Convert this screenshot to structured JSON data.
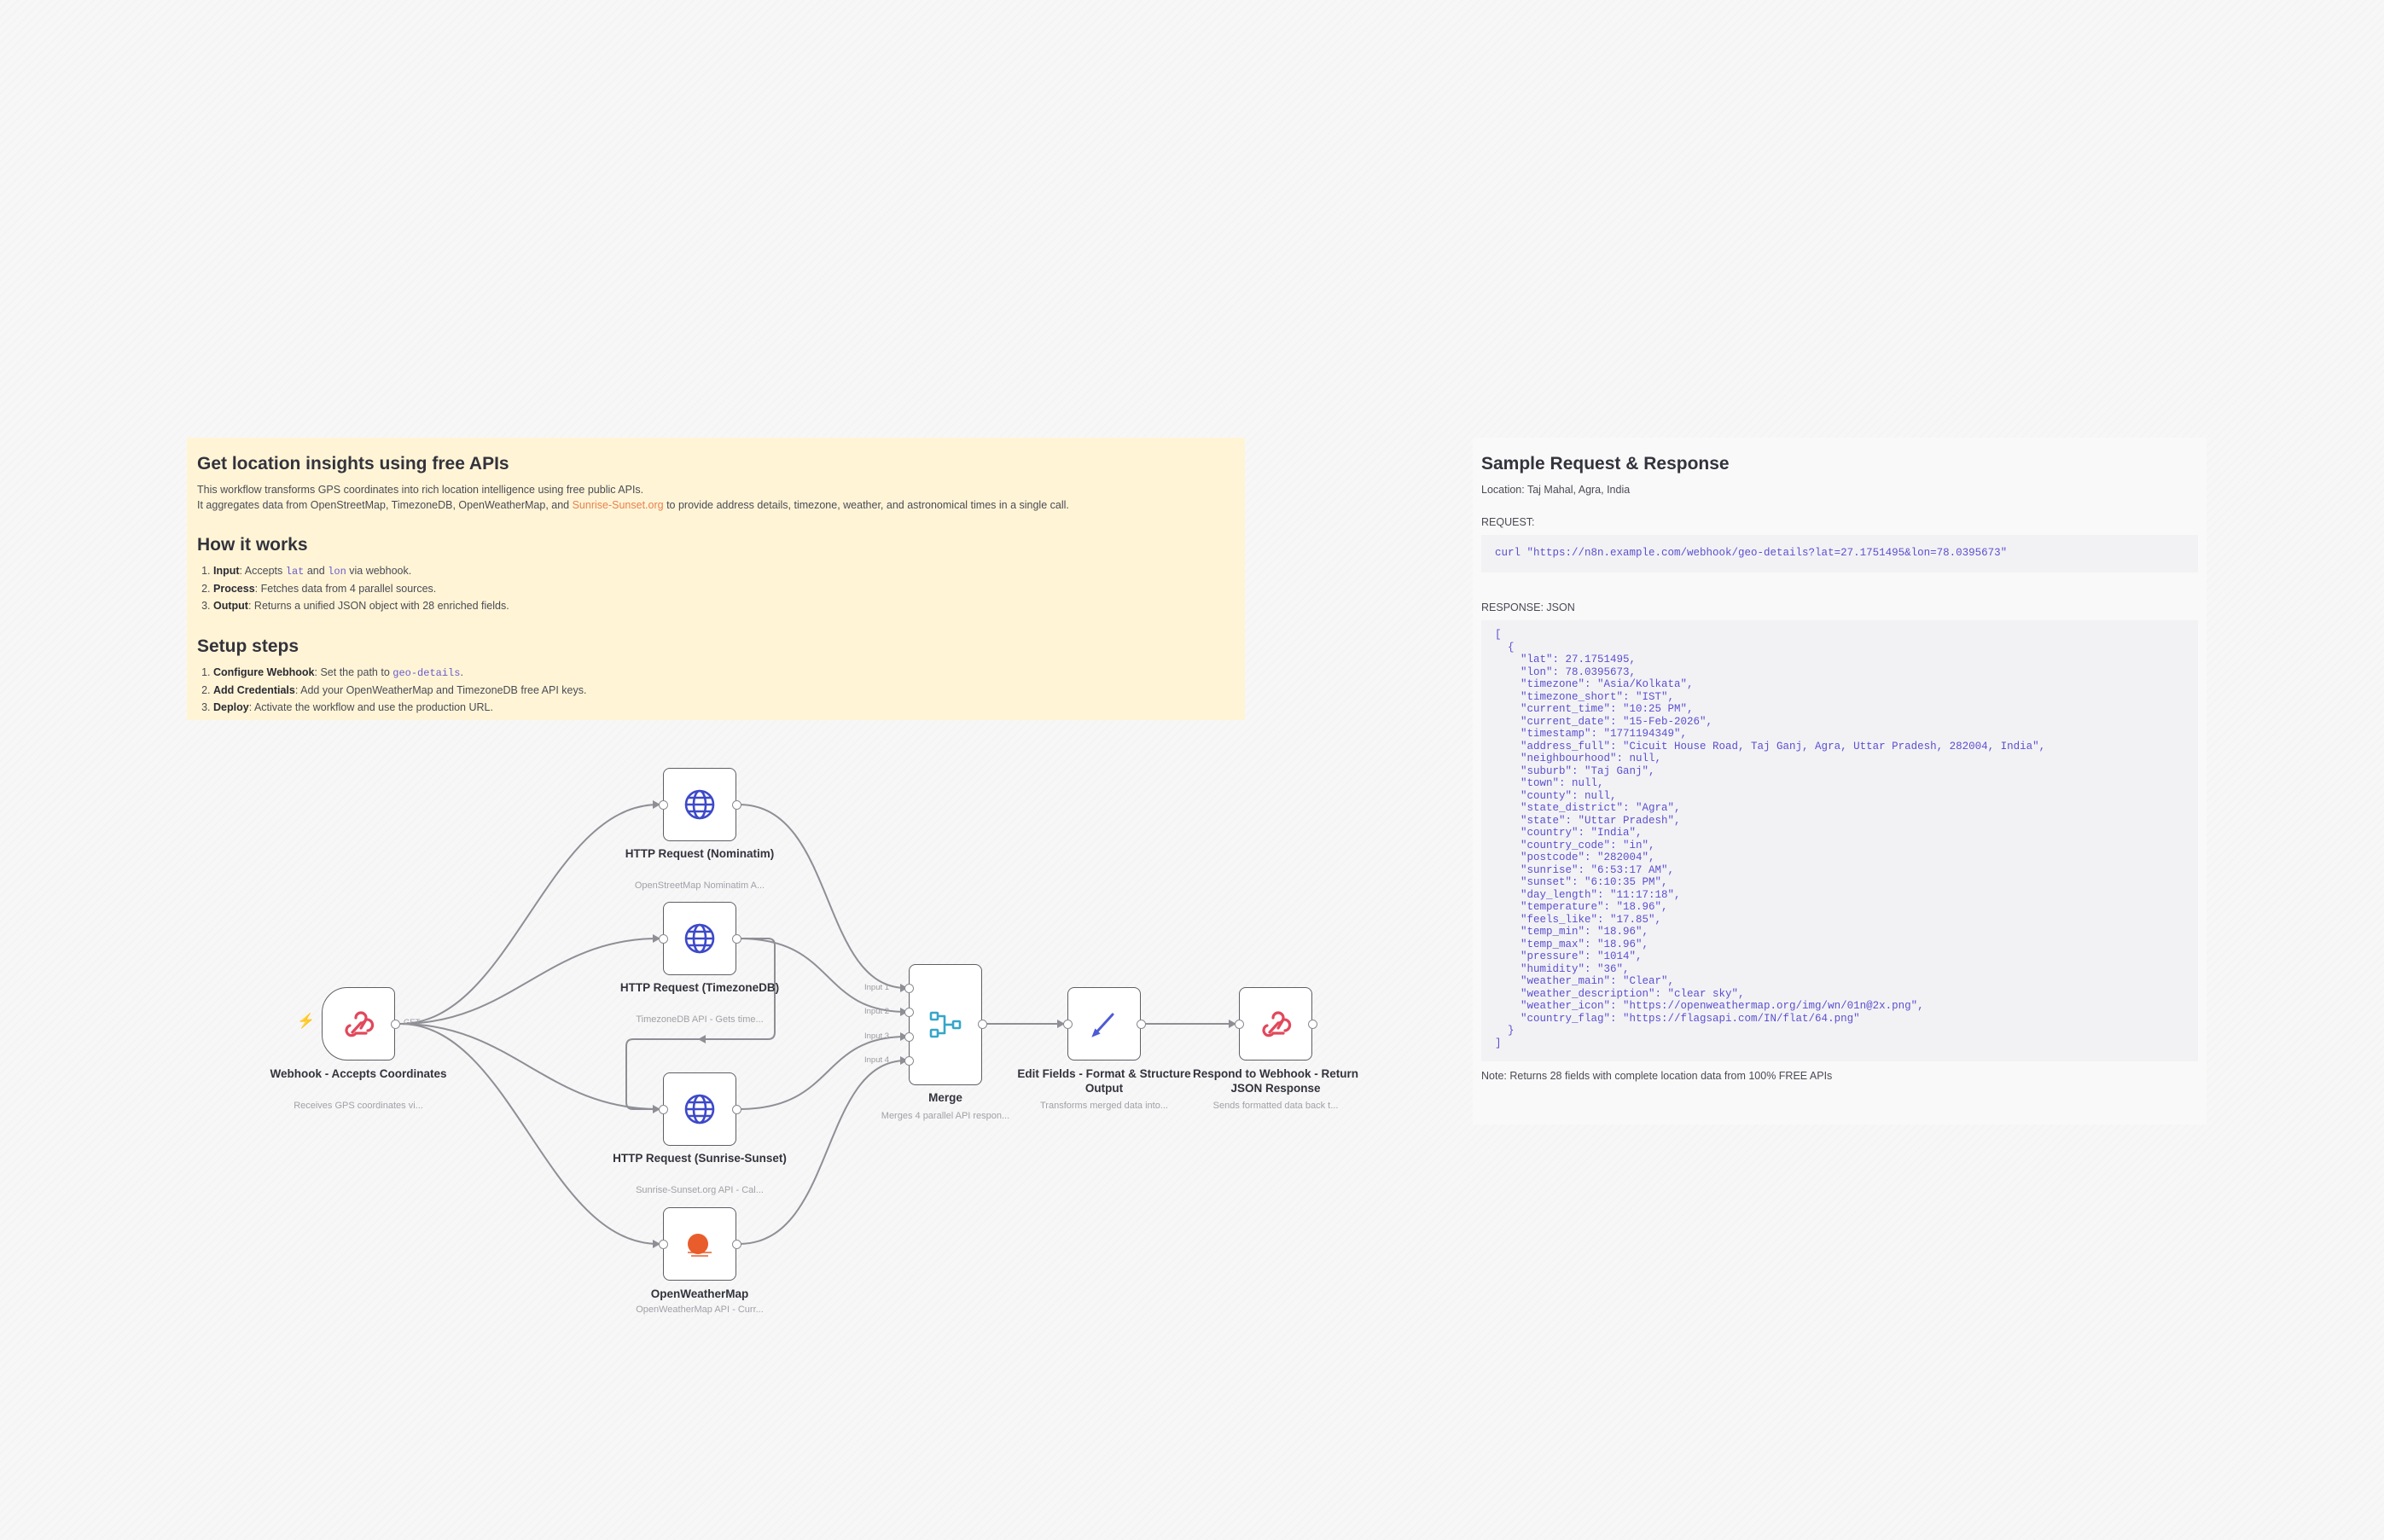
{
  "sticky_info": {
    "title": "Get location insights using free APIs",
    "intro_line1": "This workflow transforms GPS coordinates into rich location intelligence using free public APIs.",
    "intro_line2_pre": "It aggregates data from OpenStreetMap, TimezoneDB, OpenWeatherMap, and ",
    "intro_link": "Sunrise-Sunset.org",
    "intro_line2_post": " to provide address details, timezone, weather, and astronomical times in a single call.",
    "how_title": "How it works",
    "how_1_bold": "Input",
    "how_1_a": ": Accepts ",
    "how_1_code1": "lat",
    "how_1_b": " and ",
    "how_1_code2": "lon",
    "how_1_c": " via webhook.",
    "how_2_bold": "Process",
    "how_2_text": ": Fetches data from 4 parallel sources.",
    "how_3_bold": "Output",
    "how_3_text": ": Returns a unified JSON object with 28 enriched fields.",
    "setup_title": "Setup steps",
    "setup_1_bold": "Configure Webhook",
    "setup_1_a": ": Set the path to ",
    "setup_1_code": "geo-details",
    "setup_1_b": ".",
    "setup_2_bold": "Add Credentials",
    "setup_2_text": ": Add your OpenWeatherMap and TimezoneDB free API keys.",
    "setup_3_bold": "Deploy",
    "setup_3_text": ": Activate the workflow and use the production URL."
  },
  "sticky_sample": {
    "title": "Sample Request & Response",
    "location": "Location: Taj Mahal, Agra, India",
    "request_label": "REQUEST:",
    "request_code": "curl \"https://n8n.example.com/webhook/geo-details?lat=27.1751495&lon=78.0395673\"",
    "response_label": "RESPONSE: JSON",
    "response_code": "[\n  {\n    \"lat\": 27.1751495,\n    \"lon\": 78.0395673,\n    \"timezone\": \"Asia/Kolkata\",\n    \"timezone_short\": \"IST\",\n    \"current_time\": \"10:25 PM\",\n    \"current_date\": \"15-Feb-2026\",\n    \"timestamp\": \"1771194349\",\n    \"address_full\": \"Cicuit House Road, Taj Ganj, Agra, Uttar Pradesh, 282004, India\",\n    \"neighbourhood\": null,\n    \"suburb\": \"Taj Ganj\",\n    \"town\": null,\n    \"county\": null,\n    \"state_district\": \"Agra\",\n    \"state\": \"Uttar Pradesh\",\n    \"country\": \"India\",\n    \"country_code\": \"in\",\n    \"postcode\": \"282004\",\n    \"sunrise\": \"6:53:17 AM\",\n    \"sunset\": \"6:10:35 PM\",\n    \"day_length\": \"11:17:18\",\n    \"temperature\": \"18.96\",\n    \"feels_like\": \"17.85\",\n    \"temp_min\": \"18.96\",\n    \"temp_max\": \"18.96\",\n    \"pressure\": \"1014\",\n    \"humidity\": \"36\",\n    \"weather_main\": \"Clear\",\n    \"weather_description\": \"clear sky\",\n    \"weather_icon\": \"https://openweathermap.org/img/wn/01n@2x.png\",\n    \"country_flag\": \"https://flagsapi.com/IN/flat/64.png\"\n  }\n]",
    "note": "Note: Returns 28 fields with complete location data from 100% FREE APIs"
  },
  "nodes": {
    "webhook": {
      "title": "Webhook - Accepts Coordinates",
      "subtitle": "Receives GPS coordinates vi...",
      "output_label": "GET",
      "icon": "webhook-icon"
    },
    "nominatim": {
      "title": "HTTP Request (Nominatim)",
      "subtitle": "OpenStreetMap Nominatim A...",
      "icon": "globe-icon"
    },
    "timezonedb": {
      "title": "HTTP Request (TimezoneDB)",
      "subtitle": "TimezoneDB API - Gets time...",
      "icon": "globe-icon"
    },
    "sunrise": {
      "title": "HTTP Request (Sunrise-Sunset)",
      "subtitle": "Sunrise-Sunset.org API - Cal...",
      "icon": "globe-icon"
    },
    "openweather": {
      "title": "OpenWeatherMap",
      "subtitle": "OpenWeatherMap API - Curr...",
      "icon": "openweathermap-icon"
    },
    "merge": {
      "title": "Merge",
      "subtitle": "Merges 4 parallel API respon...",
      "inputs": [
        "Input 1",
        "Input 2",
        "Input 3",
        "Input 4"
      ],
      "icon": "merge-icon"
    },
    "edit": {
      "title": "Edit Fields - Format & Structure Output",
      "subtitle": "Transforms merged data into...",
      "icon": "pencil-icon"
    },
    "respond": {
      "title": "Respond to Webhook - Return JSON Response",
      "subtitle": "Sends formatted data back t...",
      "icon": "webhook-icon"
    }
  },
  "colors": {
    "sticky_yellow": "#fff5d6",
    "accent_link": "#e8804f",
    "code_purple": "#6a5acd",
    "webhook_red": "#e2475b",
    "globe_blue": "#3d49c9",
    "merge_teal": "#35a6c9",
    "owm_orange": "#e85d2b"
  }
}
